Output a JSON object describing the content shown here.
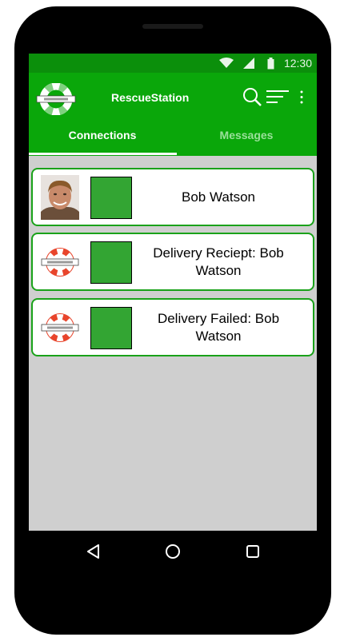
{
  "status_bar": {
    "time": "12:30",
    "icons": [
      "wifi-icon",
      "signal-icon",
      "battery-icon"
    ]
  },
  "app": {
    "title": "RescueStation",
    "logo": "lifebuoy-logo"
  },
  "toolbar": {
    "icons": [
      "search-icon",
      "filter-icon",
      "more-vert-icon"
    ]
  },
  "tabs": [
    {
      "label": "Connections",
      "active": true
    },
    {
      "label": "Messages",
      "active": false
    }
  ],
  "connections": [
    {
      "title": "Bob Watson",
      "thumbnail": "avatar"
    },
    {
      "title": "Delivery Reciept: Bob Watson",
      "thumbnail": "lifebuoy-icon"
    },
    {
      "title": "Delivery Failed: Bob Watson",
      "thumbnail": "lifebuoy-icon"
    }
  ],
  "nav_bar": {
    "icons": [
      "back-icon",
      "home-icon",
      "recents-icon"
    ]
  },
  "colors": {
    "status_bar": "#0b8f0b",
    "app_bar": "#0aa70a",
    "card_border": "#1aa21a",
    "card_square": "#33a533",
    "list_background": "#cfcfcf"
  }
}
